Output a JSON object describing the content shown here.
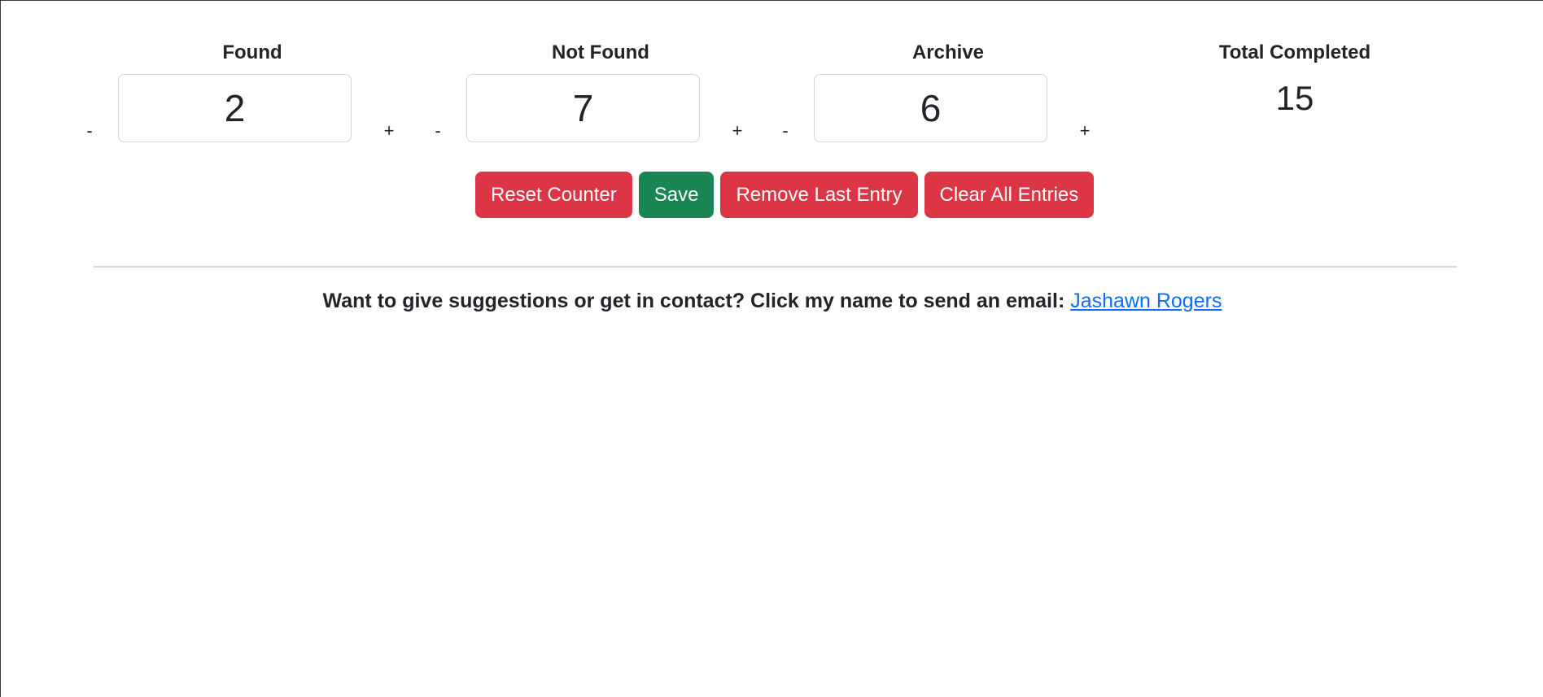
{
  "counters": [
    {
      "title": "Found",
      "value": "2",
      "decrement_label": "-",
      "increment_label": "+"
    },
    {
      "title": "Not Found",
      "value": "7",
      "decrement_label": "-",
      "increment_label": "+"
    },
    {
      "title": "Archive",
      "value": "6",
      "decrement_label": "-",
      "increment_label": "+"
    }
  ],
  "total": {
    "title": "Total Completed",
    "value": "15"
  },
  "actions": {
    "reset_label": "Reset Counter",
    "save_label": "Save",
    "remove_last_label": "Remove Last Entry",
    "clear_all_label": "Clear All Entries"
  },
  "colors": {
    "danger": "#dc3545",
    "success": "#198754",
    "link": "#0d6efd"
  },
  "footer": {
    "text": "Want to give suggestions or get in contact? Click my name to send an email: ",
    "link_text": "Jashawn Rogers"
  }
}
